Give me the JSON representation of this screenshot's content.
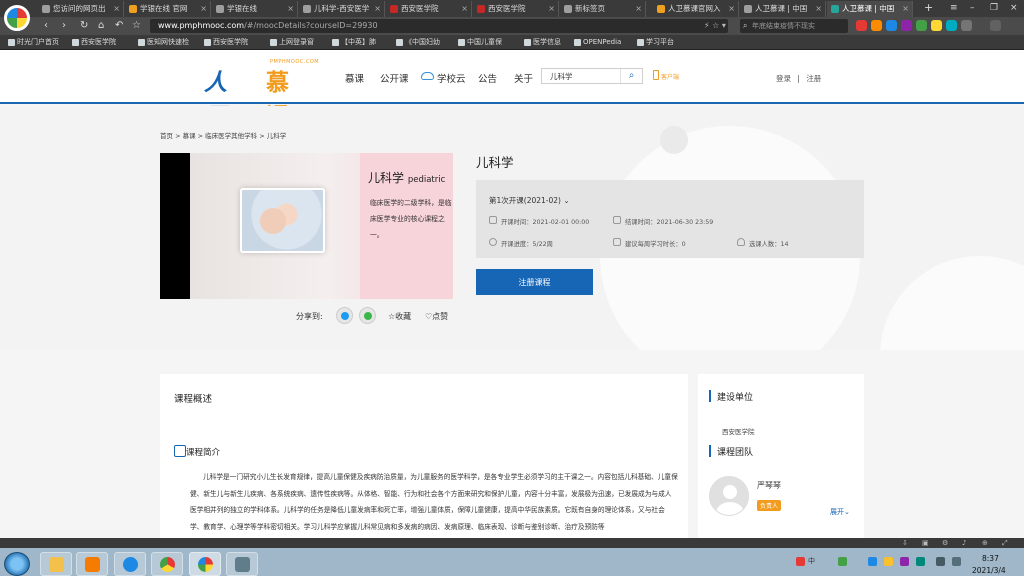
{
  "browser": {
    "tabs": [
      {
        "label": "您访问的网页出"
      },
      {
        "label": "学银在线 官网"
      },
      {
        "label": "学银在线"
      },
      {
        "label": "儿科学-西安医学"
      },
      {
        "label": "西安医学院"
      },
      {
        "label": "西安医学院"
      },
      {
        "label": "新标签页"
      },
      {
        "label": "人卫慕课官网入"
      },
      {
        "label": "人卫慕课 | 中国"
      },
      {
        "label": "人卫慕课 | 中国"
      }
    ],
    "new_tab": "+",
    "url_host": "www.pmphmooc.com",
    "url_path": "/#/moocDetails?courseID=29930",
    "search_placeholder": "年底结束疫情不现实",
    "bookmarks": [
      "时光门户首页",
      "西安医学院",
      "医知网快速检",
      "西安医学院",
      "上网登录窗",
      "【中英】肺",
      "《中国妇幼",
      "中国儿童保",
      "医学信息",
      "OPENPedia",
      "学习平台"
    ]
  },
  "site": {
    "logo_cn1": "人卫",
    "logo_cn2": "慕课",
    "logo_en": "PMPHMOOC.COM",
    "nav": [
      "慕课",
      "公开课",
      "学校云",
      "公告",
      "关于"
    ],
    "search_value": "儿科学",
    "app_link": "客户端",
    "login": "登录",
    "separator": "|",
    "register": "注册"
  },
  "course": {
    "breadcrumb": "首页 > 慕课 > 临床医学其他学科 > 儿科学",
    "cover_title": "儿科学",
    "cover_title_en": "pediatric",
    "cover_desc": "临床医学的二级学科，是临床医学专业的核心课程之一。",
    "title": "儿科学",
    "term": "第1次开课(2021-02)",
    "start_time": "开课时间：2021-02-01 00:00",
    "end_time": "结课时间：2021-06-30 23:59",
    "progress": "开课进度：5/22周",
    "weekly_hours": "建议每周学习时长：0",
    "enrolled": "选课人数：14",
    "enroll_button": "注册课程",
    "share_label": "分享到:",
    "favorite": "收藏",
    "like": "点赞"
  },
  "overview": {
    "heading": "课程概述",
    "intro_heading": "课程简介",
    "intro_body": "儿科学是一门研究小儿生长发育规律，提高儿童保健及疾病防治质量，为儿童服务的医学科学，是各专业学生必须学习的主干课之一。内容包括儿科基础、儿童保健、新生儿与新生儿疾病、各系统疾病、遗传性疾病等。从体格、智能、行为和社会各个方面来研究和保护儿童，内容十分丰富，发展极为迅速，已发展成为与成人医学相并列的独立的学科体系。儿科学的任务是降低儿童发病率和死亡率，增强儿童体质，保障儿童健康，提高中华民族素质。它既有自身的理论体系，又与社会学、教育学、心理学等学科密切相关。学习儿科学应掌握儿科常见病和多发病的病因、发病原理、临床表现、诊断与鉴别诊断、治疗及预防等"
  },
  "side": {
    "org_heading": "建设单位",
    "org_name": "西安医学院",
    "team_heading": "课程团队",
    "teacher_name": "严琴琴",
    "teacher_role": "负责人",
    "expand": "展开"
  },
  "taskbar": {
    "tray_lang": "中",
    "time": "8:37",
    "date": "2021/3/4"
  }
}
